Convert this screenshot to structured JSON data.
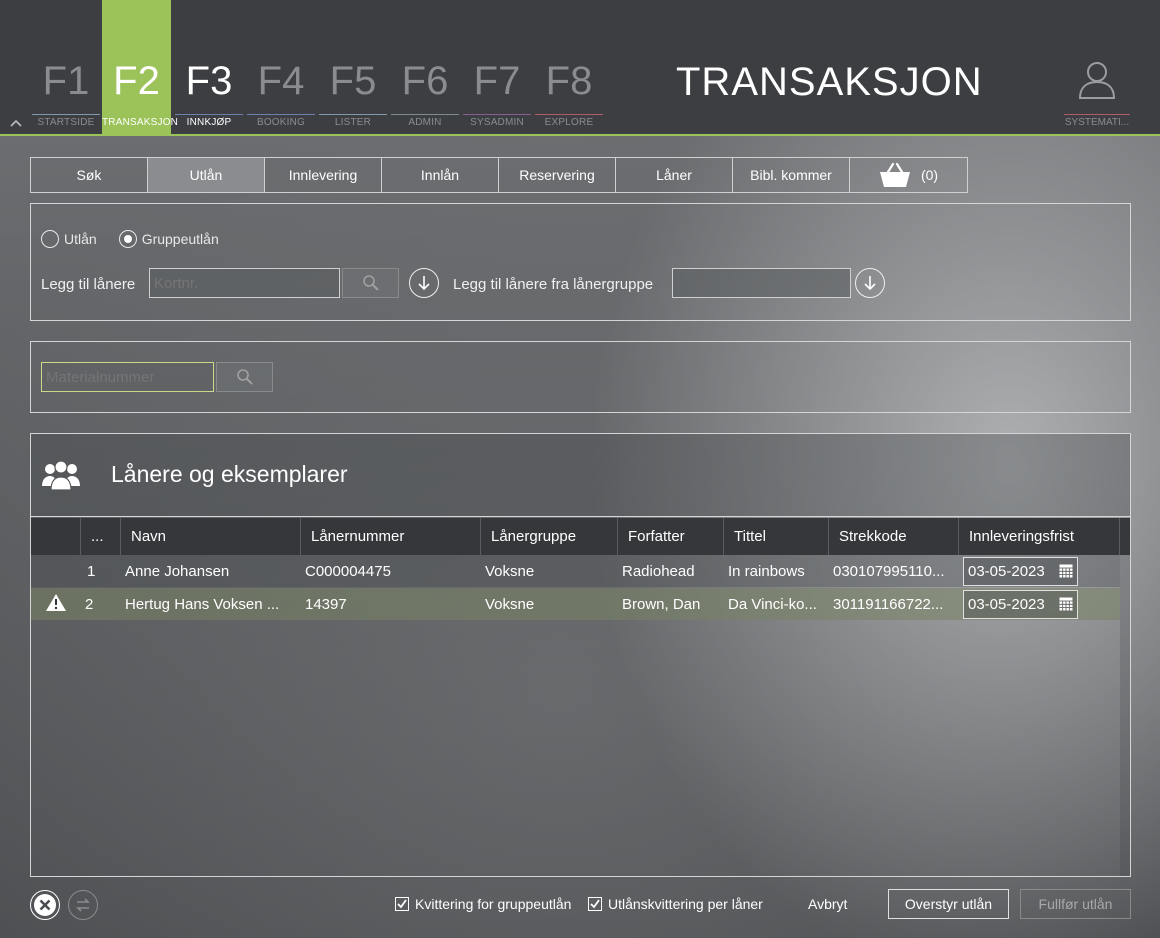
{
  "topbar": {
    "fkeys": [
      {
        "num": "F1",
        "label": "STARTSIDE"
      },
      {
        "num": "F2",
        "label": "TRANSAKSJON"
      },
      {
        "num": "F3",
        "label": "INNKJØP"
      },
      {
        "num": "F4",
        "label": "BOOKING"
      },
      {
        "num": "F5",
        "label": "LISTER"
      },
      {
        "num": "F6",
        "label": "ADMIN"
      },
      {
        "num": "F7",
        "label": "SYSADMIN"
      },
      {
        "num": "F8",
        "label": "EXPLORE"
      }
    ],
    "page_title": "TRANSAKSJON",
    "user_label": "SYSTEMATI..."
  },
  "colors": {
    "accent": "#9cc35a",
    "fkey_lines": [
      "#7d9aa6",
      "#9cc35a",
      "#e0e0e0",
      "#6d7fb0",
      "#7d9aa6",
      "#b15a68",
      "#8a5c8f",
      "#b15a68"
    ]
  },
  "tabs": [
    {
      "label": "Søk"
    },
    {
      "label": "Utlån"
    },
    {
      "label": "Innlevering"
    },
    {
      "label": "Innlån"
    },
    {
      "label": "Reservering"
    },
    {
      "label": "Låner"
    },
    {
      "label": "Bibl. kommer"
    }
  ],
  "basket": {
    "icon": "basket-icon",
    "count": "(0)"
  },
  "loan_type": {
    "options": [
      {
        "label": "Utlån",
        "selected": false
      },
      {
        "label": "Gruppeutlån",
        "selected": true
      }
    ]
  },
  "borrower": {
    "add_label": "Legg til lånere",
    "card_placeholder": "Kortnr.",
    "card_value": "",
    "group_label": "Legg til lånere fra lånergruppe",
    "group_value": ""
  },
  "material": {
    "placeholder": "Materialnummer",
    "value": ""
  },
  "grid": {
    "title": "Lånere og eksemplarer",
    "columns": [
      "...",
      "Navn",
      "Lånernummer",
      "Lånergruppe",
      "Forfatter",
      "Tittel",
      "Strekkode",
      "Innleveringsfrist"
    ],
    "rows": [
      {
        "warning": false,
        "num": "1",
        "name": "Anne Johansen",
        "borrower_no": "C000004475",
        "group": "Voksne",
        "author": "Radiohead",
        "title": "In rainbows",
        "barcode": "030107995110...",
        "due": "03-05-2023"
      },
      {
        "warning": true,
        "num": "2",
        "name": "Hertug Hans Voksen ...",
        "borrower_no": "14397",
        "group": "Voksne",
        "author": "Brown, Dan",
        "title": "Da Vinci-ko...",
        "barcode": "301191166722...",
        "due": "03-05-2023"
      }
    ]
  },
  "footer": {
    "receipt_group": {
      "label": "Kvittering for gruppeutlån",
      "checked": true
    },
    "receipt_per_borrower": {
      "label": "Utlånskvittering per låner",
      "checked": true
    },
    "cancel": "Avbryt",
    "override": "Overstyr utlån",
    "complete": "Fullfør utlån"
  }
}
